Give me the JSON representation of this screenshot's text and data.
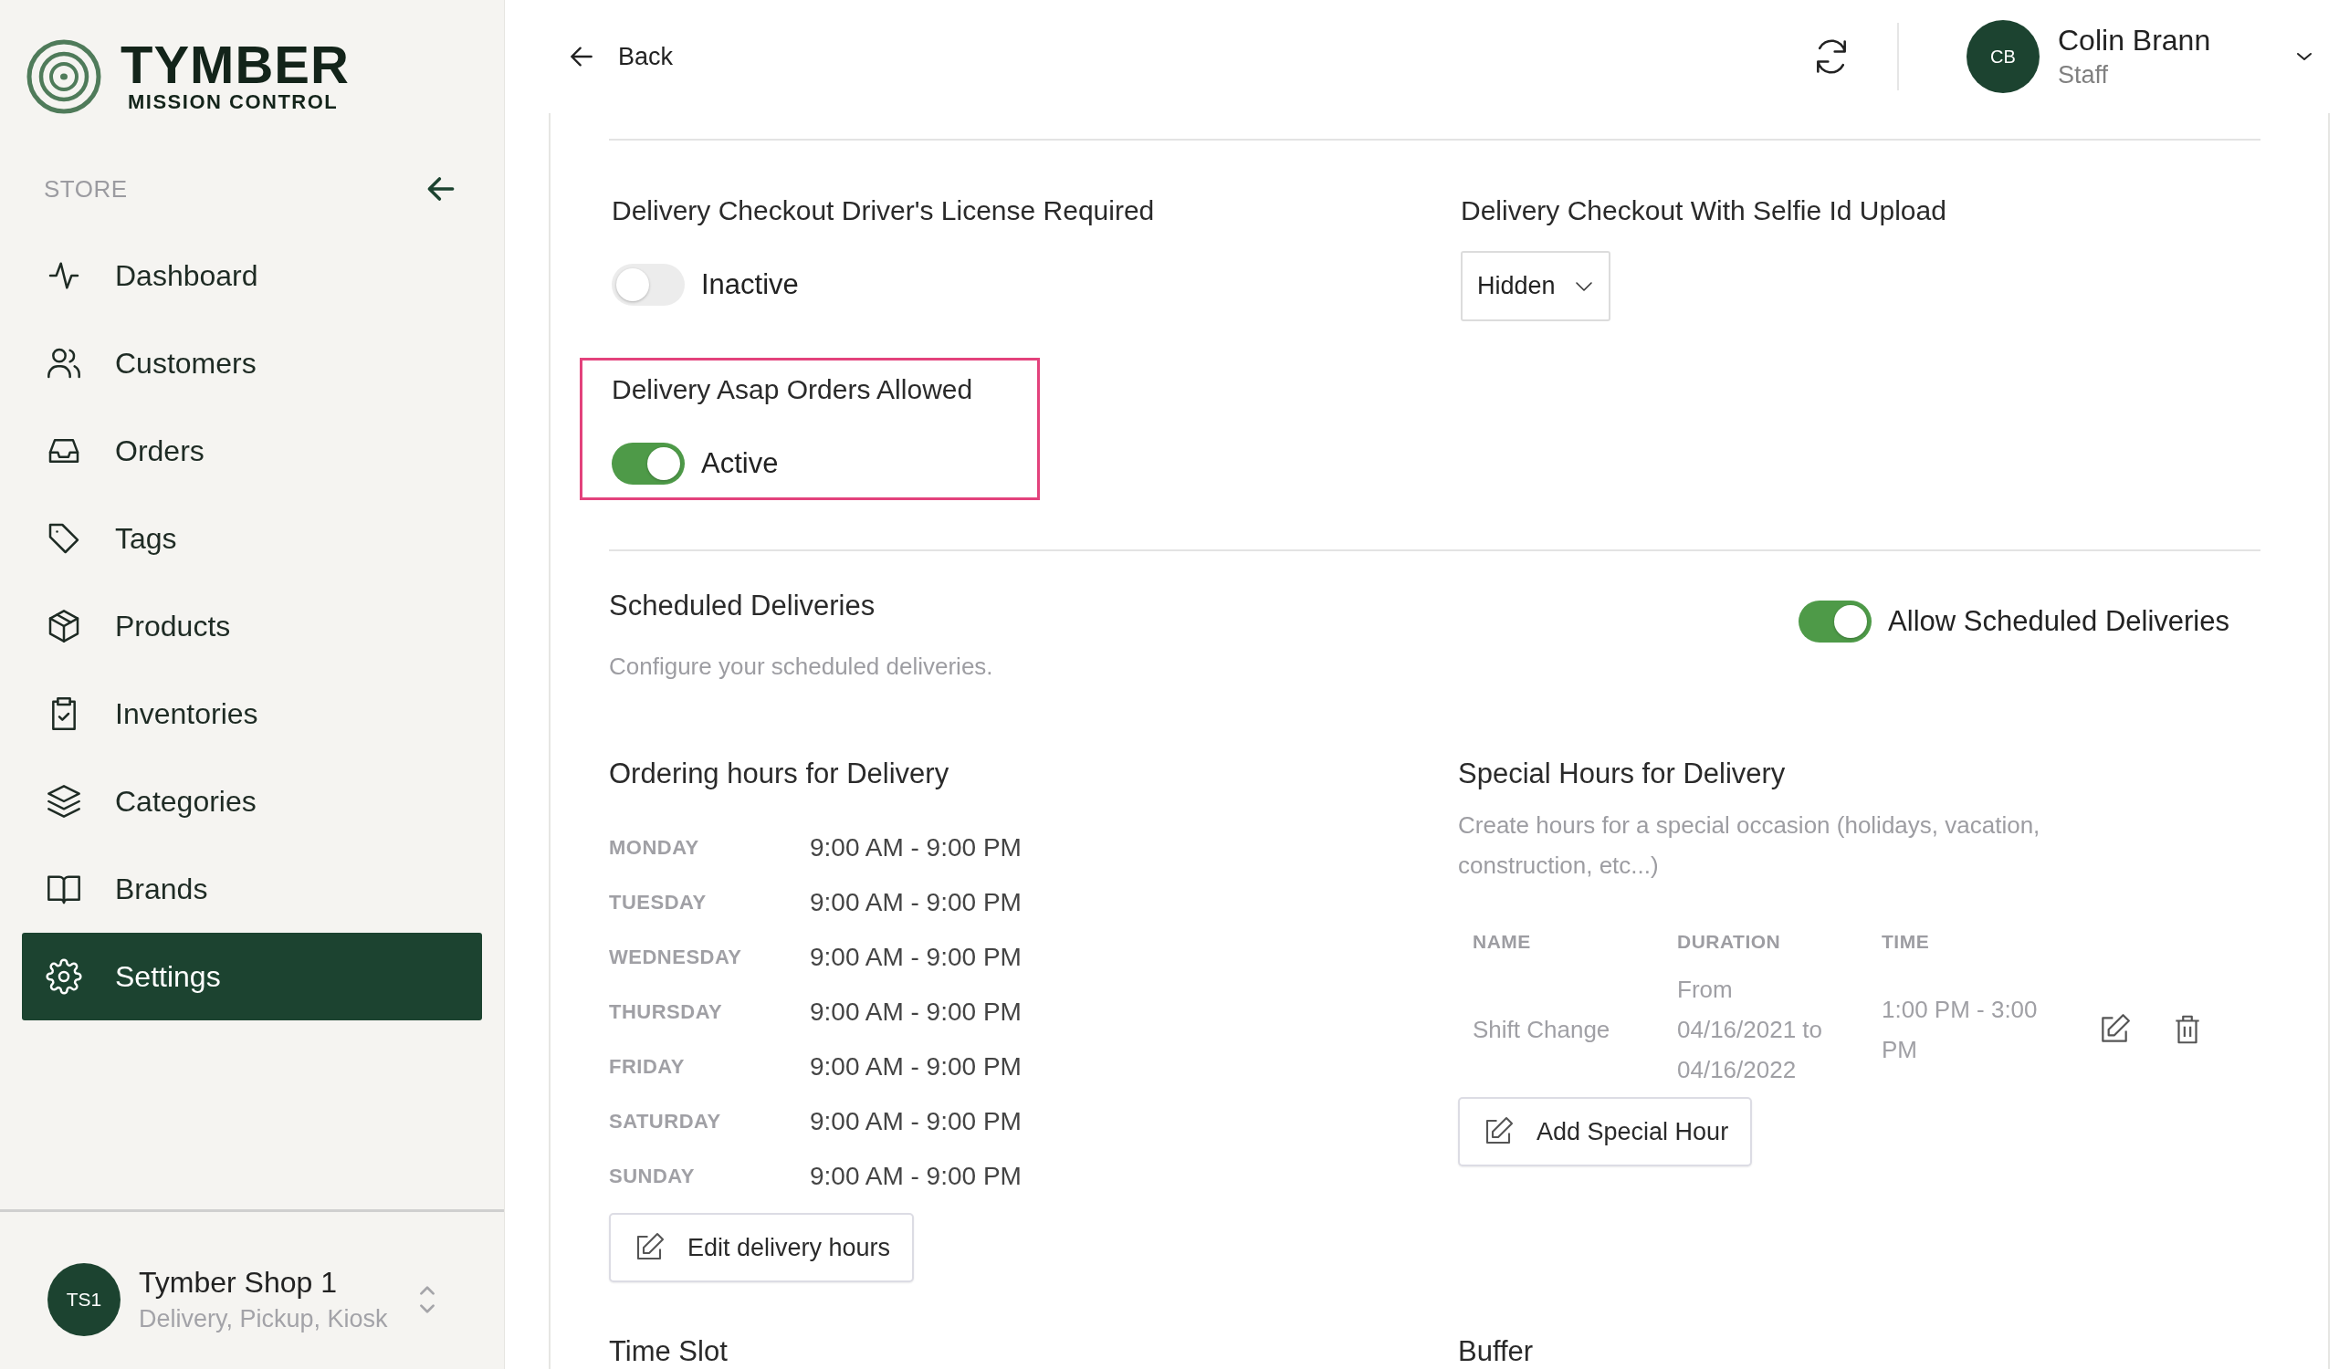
{
  "logo": {
    "title": "TYMBER",
    "subtitle": "MISSION CONTROL"
  },
  "sidebar": {
    "section": "STORE",
    "items": [
      {
        "label": "Dashboard",
        "kind": "pulse",
        "selected": false
      },
      {
        "label": "Customers",
        "kind": "users",
        "selected": false
      },
      {
        "label": "Orders",
        "kind": "inbox",
        "selected": false
      },
      {
        "label": "Tags",
        "kind": "tag",
        "selected": false
      },
      {
        "label": "Products",
        "kind": "box",
        "selected": false
      },
      {
        "label": "Inventories",
        "kind": "clipboard",
        "selected": false
      },
      {
        "label": "Categories",
        "kind": "layers",
        "selected": false
      },
      {
        "label": "Brands",
        "kind": "book",
        "selected": false
      },
      {
        "label": "Settings",
        "kind": "gear",
        "selected": true
      }
    ]
  },
  "store_switcher": {
    "initials": "TS1",
    "name": "Tymber Shop 1",
    "modes": "Delivery, Pickup, Kiosk"
  },
  "header": {
    "back": "Back",
    "user": {
      "initials": "CB",
      "name": "Colin Brann",
      "role": "Staff"
    }
  },
  "settings": [
    {
      "label": "Delivery Checkout Driver's License Required",
      "kind": "toggle",
      "on": false,
      "value": "Inactive",
      "highlighted": false
    },
    {
      "label": "Delivery Checkout With Selfie Id Upload",
      "kind": "dropdown",
      "value": "Hidden",
      "highlighted": false
    },
    {
      "label": "Delivery Asap Orders Allowed",
      "kind": "toggle",
      "on": true,
      "value": "Active",
      "highlighted": true
    }
  ],
  "scheduled": {
    "title": "Scheduled Deliveries",
    "description": "Configure your scheduled deliveries.",
    "toggle": {
      "label": "Allow Scheduled Deliveries",
      "on": true
    }
  },
  "ordering_hours": {
    "title": "Ordering hours for Delivery",
    "days": [
      {
        "day": "MONDAY",
        "hours": "9:00 AM - 9:00 PM"
      },
      {
        "day": "TUESDAY",
        "hours": "9:00 AM - 9:00 PM"
      },
      {
        "day": "WEDNESDAY",
        "hours": "9:00 AM - 9:00 PM"
      },
      {
        "day": "THURSDAY",
        "hours": "9:00 AM - 9:00 PM"
      },
      {
        "day": "FRIDAY",
        "hours": "9:00 AM - 9:00 PM"
      },
      {
        "day": "SATURDAY",
        "hours": "9:00 AM - 9:00 PM"
      },
      {
        "day": "SUNDAY",
        "hours": "9:00 AM - 9:00 PM"
      }
    ],
    "edit_button": "Edit delivery hours"
  },
  "special_hours": {
    "title": "Special Hours for Delivery",
    "description": "Create hours for a special occasion (holidays, vacation, construction, etc...)",
    "columns": [
      "NAME",
      "DURATION",
      "TIME"
    ],
    "rows": [
      {
        "name": "Shift Change",
        "duration": "From 04/16/2021 to 04/16/2022",
        "time": "1:00 PM - 3:00 PM"
      }
    ],
    "add_button": "Add Special Hour"
  },
  "bottom_sections": [
    "Time Slot",
    "Buffer"
  ]
}
